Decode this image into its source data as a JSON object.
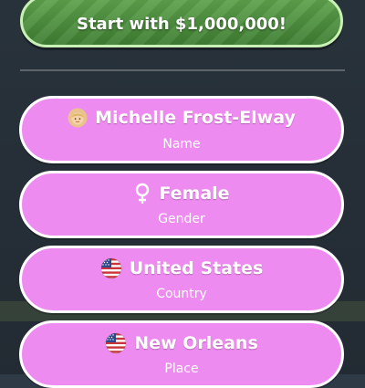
{
  "start_button": {
    "label": "Start with $1,000,000!"
  },
  "fields": [
    {
      "value": "Michelle Frost-Elway",
      "caption": "Name",
      "icon": "person-emoji-icon"
    },
    {
      "value": "Female",
      "caption": "Gender",
      "icon": "female-symbol-icon"
    },
    {
      "value": "United States",
      "caption": "Country",
      "icon": "us-flag-icon"
    },
    {
      "value": "New Orleans",
      "caption": "Place",
      "icon": "us-flag-icon"
    }
  ],
  "colors": {
    "pill": "#ee8bf0",
    "pill_border": "#ffffff",
    "start_green": "#4f9440",
    "background": "#2e3a45"
  }
}
